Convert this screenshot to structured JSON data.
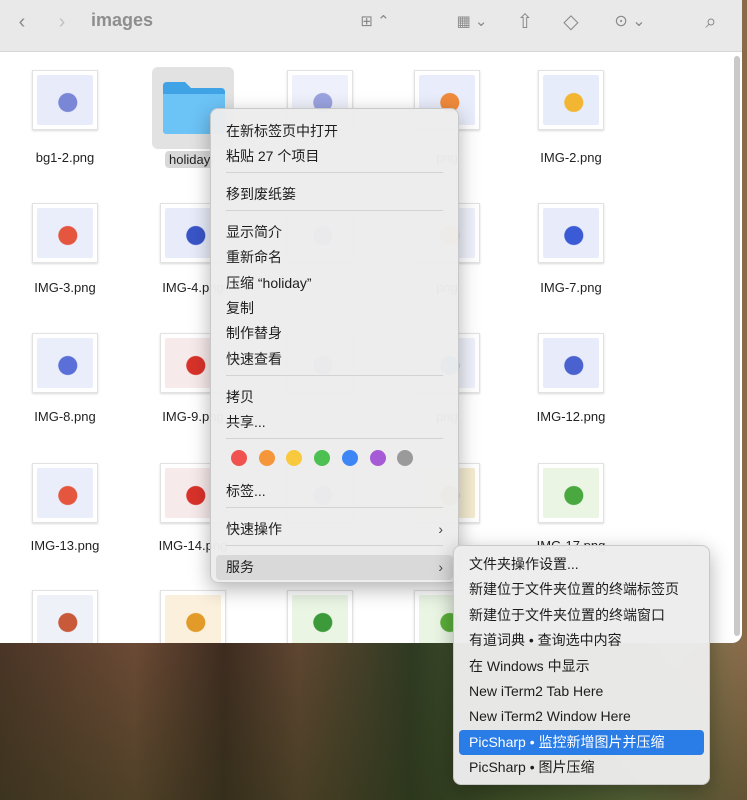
{
  "window": {
    "title": "images"
  },
  "toolbar": {
    "icons": [
      "chevron-left-icon",
      "chevron-right-icon",
      "icon-view-grid-icon",
      "group-by-icon",
      "share-icon",
      "tag-icon",
      "more-actions-icon",
      "search-icon"
    ]
  },
  "files": [
    {
      "name": "bg1-2.png",
      "colors": [
        "#e8ecfa",
        "#7a86d6"
      ]
    },
    {
      "name": "holiday",
      "type": "folder"
    },
    {
      "name": "",
      "colors": [
        "#eef0fb",
        "#9aa3e0"
      ]
    },
    {
      "name": "png",
      "colors": [
        "#e9edfb",
        "#f08a3b"
      ]
    },
    {
      "name": "IMG-2.png",
      "colors": [
        "#e7ecfb",
        "#f2b632"
      ]
    },
    {
      "name": "IMG-3.png",
      "colors": [
        "#eaeefb",
        "#e5563f"
      ]
    },
    {
      "name": "IMG-4.png",
      "colors": [
        "#e8ecfa",
        "#3a55c8"
      ]
    },
    {
      "name": "",
      "colors": [
        "#eef0fb",
        "#9aa3e0"
      ]
    },
    {
      "name": "png",
      "colors": [
        "#eef0fb",
        "#f2a33a"
      ]
    },
    {
      "name": "IMG-7.png",
      "colors": [
        "#e8ecfa",
        "#3b5bd6"
      ]
    },
    {
      "name": "IMG-8.png",
      "colors": [
        "#eaeefb",
        "#5a6fd8"
      ]
    },
    {
      "name": "IMG-9.png",
      "colors": [
        "#f7eaea",
        "#d8322a"
      ]
    },
    {
      "name": "",
      "colors": [
        "#eef0fb",
        "#9aa3e0"
      ]
    },
    {
      "name": "png",
      "colors": [
        "#eef0fb",
        "#4aa3c8"
      ]
    },
    {
      "name": "IMG-12.png",
      "colors": [
        "#e8ecfa",
        "#4a62d0"
      ]
    },
    {
      "name": "IMG-13.png",
      "colors": [
        "#eaeefb",
        "#e5563f"
      ]
    },
    {
      "name": "IMG-14.png",
      "colors": [
        "#f7eaea",
        "#d8322a"
      ]
    },
    {
      "name": "",
      "colors": [
        "#eef0fb",
        "#9aa3e0"
      ]
    },
    {
      "name": "",
      "colors": [
        "#f5ecd0",
        "#d89a28"
      ]
    },
    {
      "name": "IMG-17.png",
      "colors": [
        "#eaf5e4",
        "#4aa840"
      ]
    },
    {
      "name": "",
      "colors": [
        "#eef2f8",
        "#c85a3a"
      ]
    },
    {
      "name": "",
      "colors": [
        "#fbf0dc",
        "#e29a28"
      ]
    },
    {
      "name": "",
      "colors": [
        "#eaf5e4",
        "#3c9a3a"
      ]
    },
    {
      "name": "",
      "colors": [
        "#eaf5e4",
        "#5aae3a"
      ]
    },
    {
      "name": "",
      "colors": [
        "#fff",
        "#fff"
      ]
    }
  ],
  "context_menu": {
    "items": [
      "在新标签页中打开",
      "粘贴 27 个项目",
      "移到废纸篓",
      "显示简介",
      "重新命名",
      "压缩 “holiday”",
      "复制",
      "制作替身",
      "快速查看",
      "拷贝",
      "共享...",
      "标签...",
      "快速操作",
      "服务"
    ],
    "tag_colors": [
      "#f0524f",
      "#f5963a",
      "#f8c93c",
      "#4cc050",
      "#3e86f5",
      "#a65ad6",
      "#9a9a9a"
    ]
  },
  "services_menu": {
    "items": [
      "文件夹操作设置...",
      "新建位于文件夹位置的终端标签页",
      "新建位于文件夹位置的终端窗口",
      "有道词典 • 查询选中内容",
      "在 Windows 中显示",
      "New iTerm2 Tab Here",
      "New iTerm2 Window Here",
      "PicSharp • 监控新增图片并压缩",
      "PicSharp • 图片压缩"
    ],
    "highlighted_index": 7,
    "highlight_color": "#2a7ce6"
  }
}
